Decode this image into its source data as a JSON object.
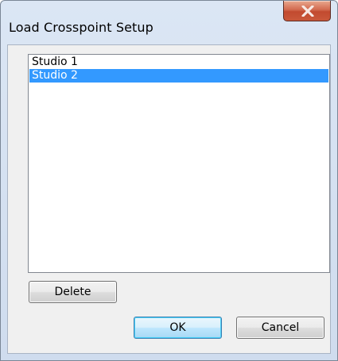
{
  "window": {
    "title": "Load Crosspoint Setup",
    "close_icon": "close-icon"
  },
  "list": {
    "items": [
      {
        "label": "Studio 1",
        "selected": false
      },
      {
        "label": "Studio 2",
        "selected": true
      }
    ],
    "selection_color": "#3399ff"
  },
  "buttons": {
    "delete_label": "Delete",
    "ok_label": "OK",
    "cancel_label": "Cancel"
  }
}
